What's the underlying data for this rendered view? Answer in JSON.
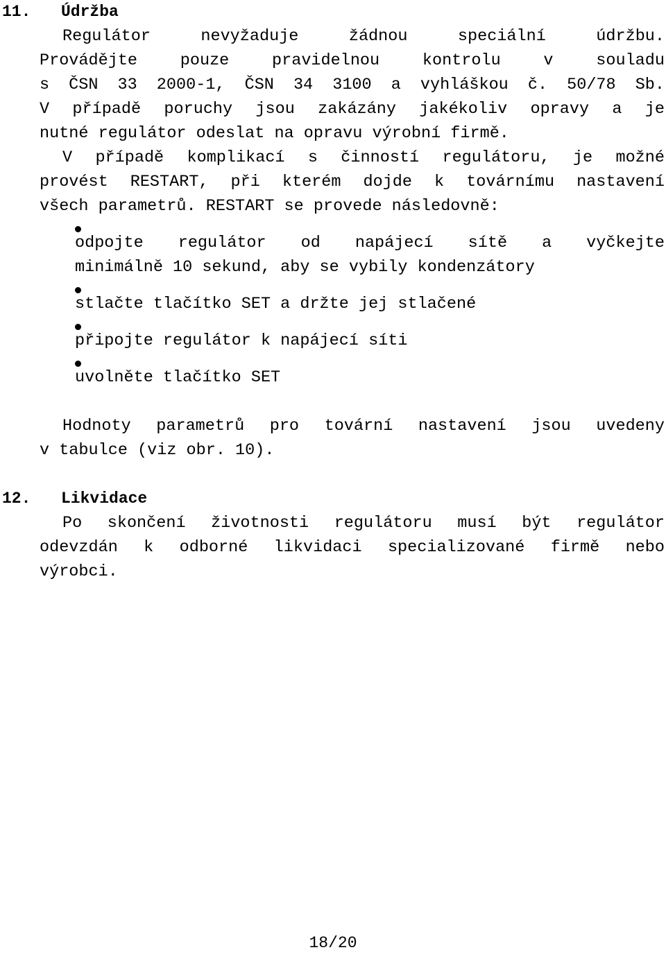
{
  "document": {
    "language": "cs",
    "page_footer": "18/20"
  },
  "sections": [
    {
      "number": "11.",
      "title": "Údržba",
      "paragraphs": [
        {
          "id": "p1",
          "lines": [
            "Regulátor  nevyžaduje  žádnou  speciální  údržbu.",
            "Provádějte  pouze  pravidelnou  kontrolu  v  souladu",
            "s ČSN 33 2000-1, ČSN 34 3100 a vyhláškou č. 50/78 Sb.",
            "V případě poruchy jsou zakázány jakékoliv opravy a je",
            "nutné regulátor odeslat na opravu výrobní firmě."
          ],
          "text": "Regulátor nevyžaduje žádnou speciální údržbu. Provádějte pouze pravidelnou kontrolu v souladu s ČSN 33 2000-1, ČSN 34 3100 a vyhláškou č. 50/78 Sb. V případě poruchy jsou zakázány jakékoliv opravy a je nutné regulátor odeslat na opravu výrobní firmě."
        },
        {
          "id": "p2",
          "lines": [
            "V případě komplikací s činností regulátoru, je možné",
            "provést RESTART, při kterém dojde k továrnímu nastavení",
            "všech parametrů. RESTART se provede následovně:"
          ],
          "text": "V případě komplikací s činností regulátoru, je možné provést RESTART, při kterém dojde k továrnímu nastavení všech parametrů. RESTART se provede následovně:"
        }
      ],
      "bullets": [
        {
          "lines": [
            "odpojte  regulátor  od  napájecí  sítě  a  vyčkejte",
            "minimálně 10 sekund, aby se vybily kondenzátory"
          ],
          "text": "odpojte regulátor od napájecí sítě a vyčkejte minimálně 10 sekund, aby se vybily kondenzátory"
        },
        {
          "lines": [
            "stlačte tlačítko SET a držte jej stlačené"
          ],
          "text": "stlačte tlačítko SET a držte jej stlačené"
        },
        {
          "lines": [
            "připojte regulátor k napájecí síti"
          ],
          "text": "připojte regulátor k napájecí síti"
        },
        {
          "lines": [
            "uvolněte tlačítko SET"
          ],
          "text": "uvolněte tlačítko SET"
        }
      ],
      "paragraphs_after": [
        {
          "id": "p3",
          "lines": [
            "Hodnoty parametrů pro tovární nastavení jsou uvedeny",
            "v tabulce (viz obr. 10)."
          ],
          "text": "Hodnoty parametrů pro tovární nastavení jsou uvedeny v tabulce (viz obr. 10)."
        }
      ]
    },
    {
      "number": "12.",
      "title": "Likvidace",
      "paragraphs": [
        {
          "id": "p4",
          "lines": [
            "Po skončení životnosti regulátoru musí být regulátor",
            "odevzdán k odborné likvidaci specializované firmě nebo",
            "výrobci."
          ],
          "text": "Po skončení životnosti regulátoru musí být regulátor odevzdán k odborné likvidaci specializované firmě nebo výrobci."
        }
      ]
    }
  ]
}
